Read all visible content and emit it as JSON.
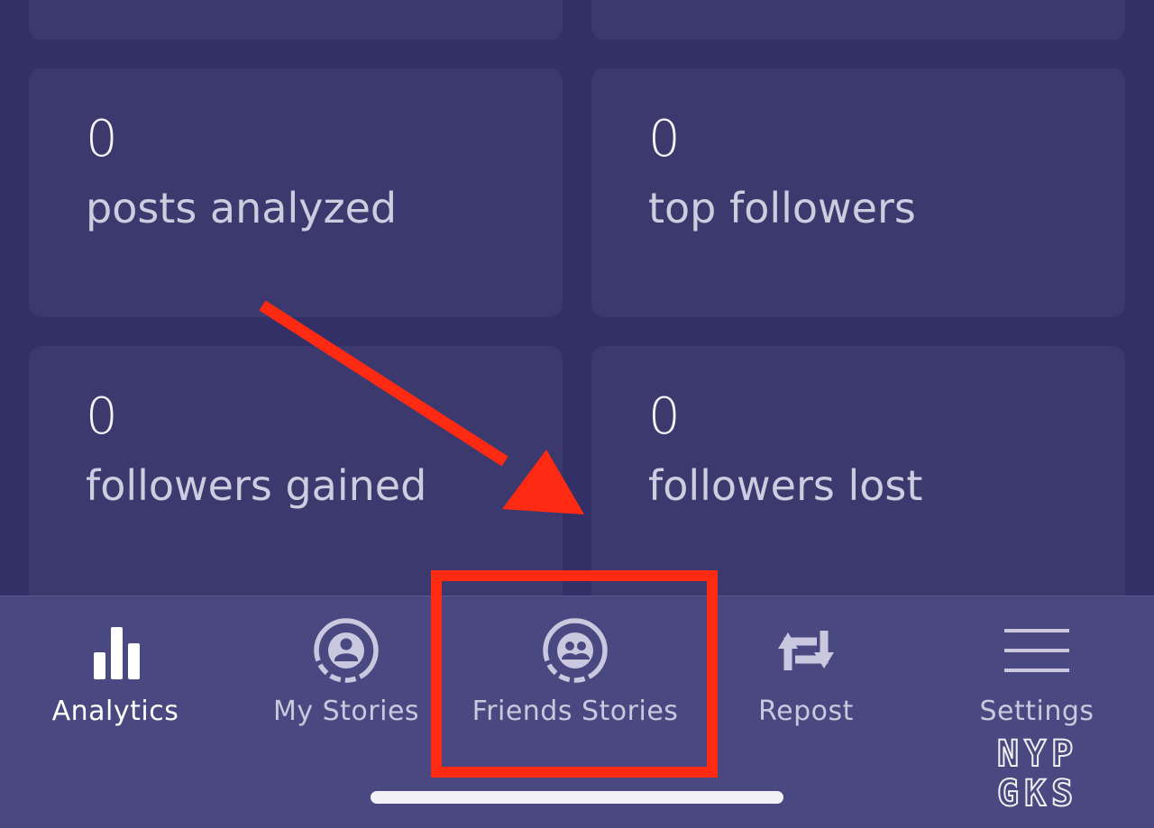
{
  "stats": [
    {
      "value": "0",
      "label": "posts analyzed"
    },
    {
      "value": "0",
      "label": "top followers"
    },
    {
      "value": "0",
      "label": "followers gained"
    },
    {
      "value": "0",
      "label": "followers lost"
    }
  ],
  "tabs": [
    {
      "label": "Analytics",
      "icon": "bar-chart-icon",
      "active": true
    },
    {
      "label": "My Stories",
      "icon": "person-story-ring-icon",
      "active": false
    },
    {
      "label": "Friends Stories",
      "icon": "group-story-ring-icon",
      "active": false
    },
    {
      "label": "Repost",
      "icon": "repost-icon",
      "active": false
    },
    {
      "label": "Settings",
      "icon": "menu-icon",
      "active": false
    }
  ],
  "watermark": {
    "line1": "NYP",
    "line2": "GKS"
  },
  "colors": {
    "background": "#332f67",
    "card": "#3c396f",
    "tabbar": "#4a4880",
    "annotation": "#ff2a12"
  }
}
